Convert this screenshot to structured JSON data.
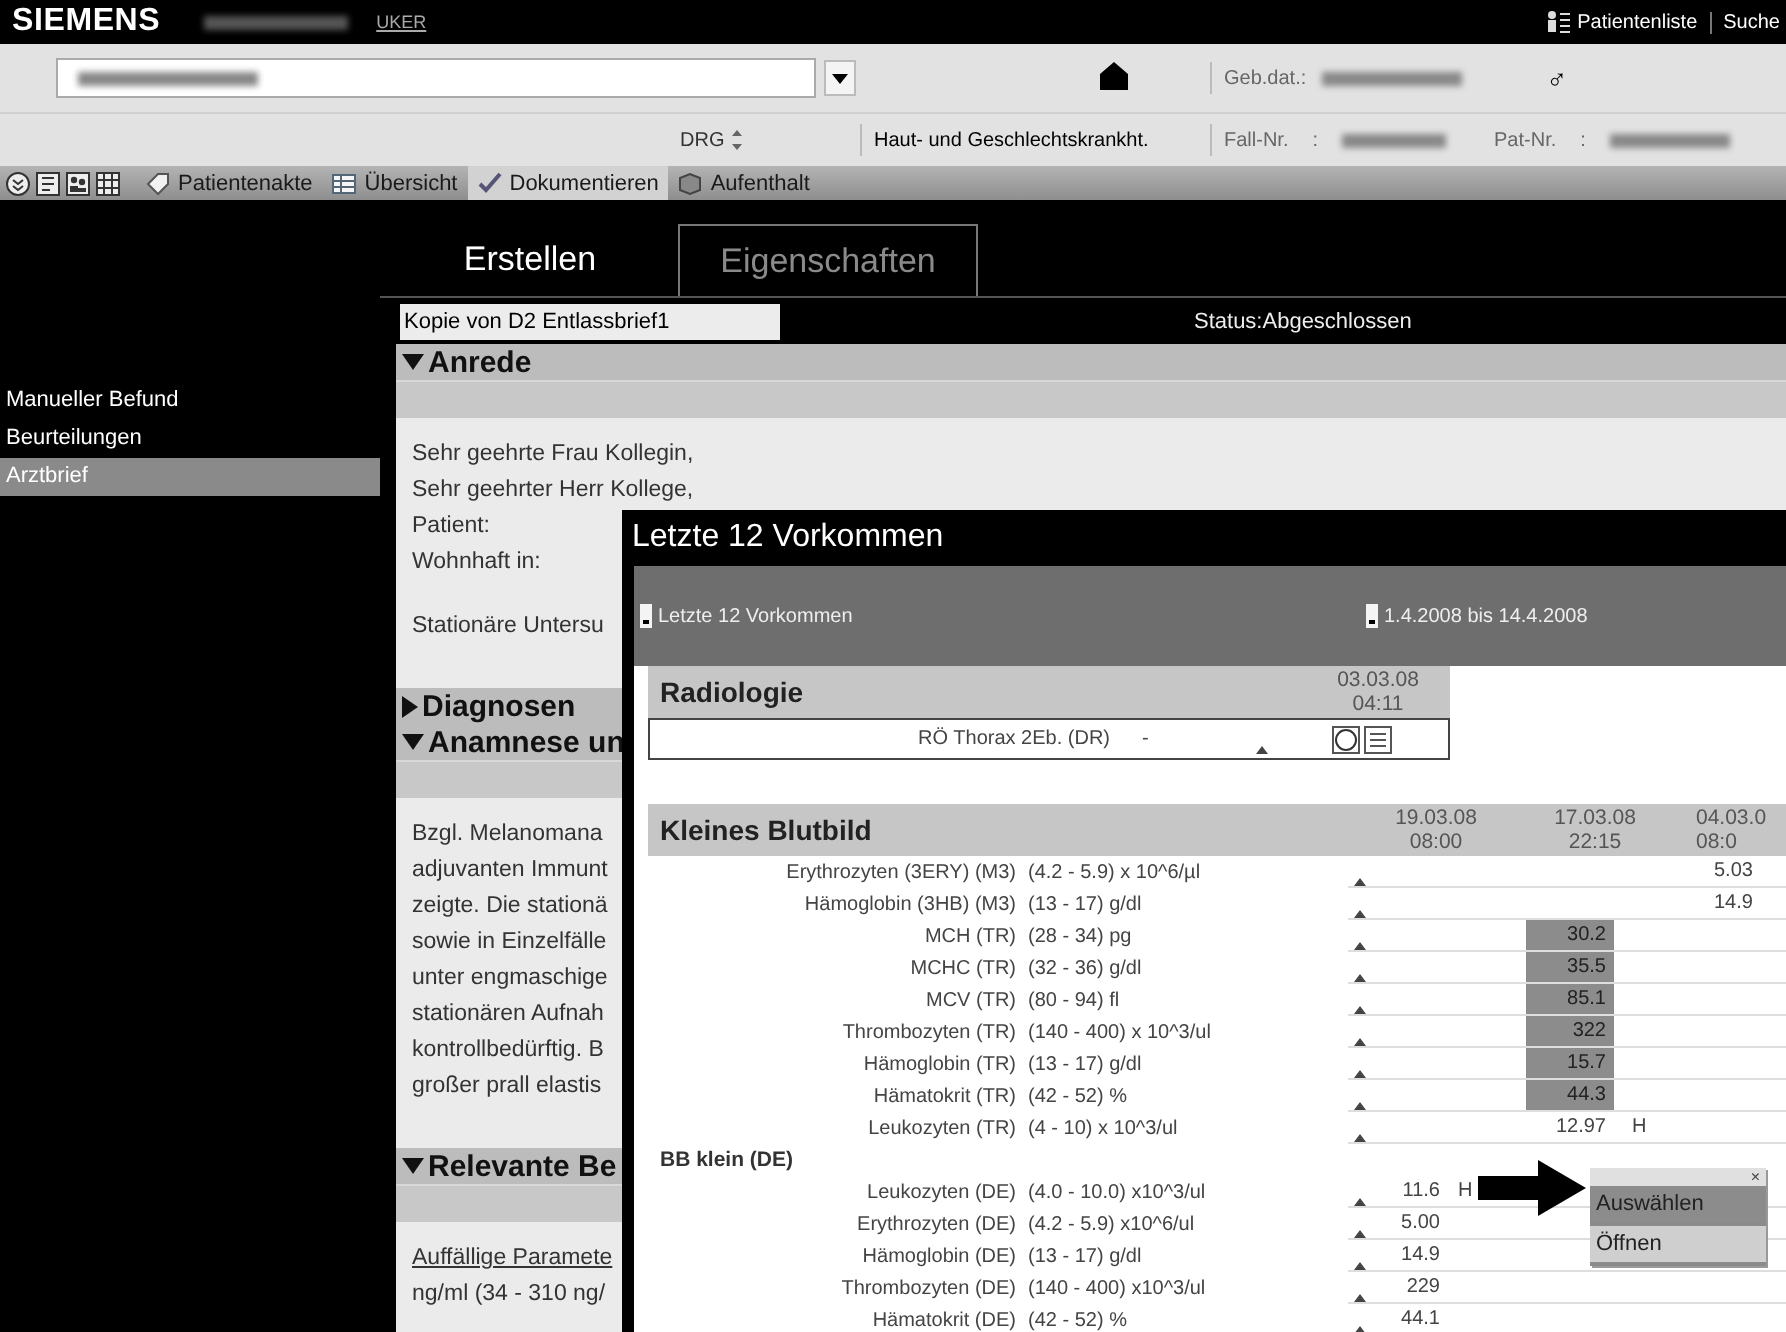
{
  "header": {
    "logo": "SIEMENS",
    "link": "UKER",
    "patient_list": "Patientenliste",
    "search": "Suche"
  },
  "patient_bar": {
    "birth_label": "Geb.dat.:",
    "gender": "♂",
    "drg": "DRG",
    "department": "Haut- und Geschlechtskrankht.",
    "case_label": "Fall-Nr.",
    "case_separator": ":",
    "patient_number_label": "Pat-Nr.",
    "patient_number_separator": ":"
  },
  "toolbar": {
    "items": [
      {
        "label": "Patientenakte",
        "selected": false
      },
      {
        "label": "Übersicht",
        "selected": false
      },
      {
        "label": "Dokumentieren",
        "selected": true
      },
      {
        "label": "Aufenthalt",
        "selected": false
      }
    ]
  },
  "sidebar": {
    "items": [
      {
        "label": "Manueller Befund",
        "selected": false
      },
      {
        "label": "Beurteilungen",
        "selected": false
      },
      {
        "label": "Arztbrief",
        "selected": true
      }
    ]
  },
  "tabs": [
    {
      "label": "Erstellen",
      "selected": true
    },
    {
      "label": "Eigenschaften",
      "selected": false
    }
  ],
  "document": {
    "title": "Kopie von D2 Entlassbrief1",
    "status": "Status:Abgeschlossen",
    "sections": [
      {
        "title": "Anrede",
        "expanded": true,
        "paragraphs": [
          [
            {
              "kind": "text",
              "text": "Sehr geehrte Frau Kollegin,"
            },
            {
              "kind": "text",
              "text": "Sehr geehrter Herr Kollege,"
            },
            {
              "kind": "text",
              "text": "Patient:"
            },
            {
              "kind": "text",
              "text": "Wohnhaft in:"
            }
          ],
          [
            {
              "kind": "text",
              "text": "Stationäre Untersu"
            }
          ]
        ]
      },
      {
        "title": "Diagnosen",
        "expanded": false
      },
      {
        "title": "Anamnese un",
        "expanded": true,
        "paragraphs": [
          [
            {
              "kind": "text",
              "text": "Bzgl. Melanomana"
            },
            {
              "kind": "text",
              "text": "adjuvanten Immunt"
            },
            {
              "kind": "text",
              "text": "zeigte. Die stationä"
            },
            {
              "kind": "text",
              "text": "sowie in Einzelfälle"
            },
            {
              "kind": "text",
              "text": "unter engmaschige"
            },
            {
              "kind": "text",
              "text": "stationären Aufnah"
            },
            {
              "kind": "text",
              "text": "kontrollbedürftig. B"
            },
            {
              "kind": "text",
              "text": "großer prall elastis"
            }
          ]
        ]
      },
      {
        "title": "Relevante Be",
        "expanded": true,
        "paragraphs": [
          [
            {
              "kind": "link",
              "text": "Auffällige Paramete"
            },
            {
              "kind": "text",
              "text": "ng/ml (34 - 310 ng/"
            }
          ]
        ]
      }
    ]
  },
  "popup": {
    "title": "Letzte 12 Vorkommen",
    "filter": "Letzte 12 Vorkommen",
    "range": "1.4.2008 bis 14.4.2008",
    "radiology": {
      "title": "Radiologie",
      "dates": [
        {
          "date": "03.03.08",
          "time": "04:11"
        }
      ],
      "rows": [
        {
          "label": "RÖ Thorax 2Eb. (DR)",
          "range": "-"
        }
      ]
    },
    "blood": {
      "title": "Kleines Blutbild",
      "dates": [
        {
          "date": "19.03.08",
          "time": "08:00"
        },
        {
          "date": "17.03.08",
          "time": "22:15"
        },
        {
          "date": "04.03.0",
          "time": "08:0"
        }
      ],
      "groups": [
        {
          "rows": [
            {
              "label": "Erythrozyten (3ERY) (M3)",
              "range": "(4.2 - 5.9) x 10^6/µl",
              "values": {
                "column_3": {
                  "text": "5.03",
                  "highlighted": false
                }
              }
            },
            {
              "label": "Hämoglobin (3HB) (M3)",
              "range": "(13 - 17) g/dl",
              "values": {
                "column_3": {
                  "text": "14.9",
                  "highlighted": false
                }
              }
            },
            {
              "label": "MCH (TR)",
              "range": "(28 - 34) pg",
              "values": {
                "column_2": {
                  "text": "30.2",
                  "highlighted": true
                }
              }
            },
            {
              "label": "MCHC (TR)",
              "range": "(32 - 36) g/dl",
              "values": {
                "column_2": {
                  "text": "35.5",
                  "highlighted": true
                }
              }
            },
            {
              "label": "MCV (TR)",
              "range": "(80 - 94) fl",
              "values": {
                "column_2": {
                  "text": "85.1",
                  "highlighted": true
                }
              }
            },
            {
              "label": "Thrombozyten (TR)",
              "range": "(140 - 400) x 10^3/ul",
              "values": {
                "column_2": {
                  "text": "322",
                  "highlighted": true
                }
              }
            },
            {
              "label": "Hämoglobin (TR)",
              "range": "(13 - 17) g/dl",
              "values": {
                "column_2": {
                  "text": "15.7",
                  "highlighted": true
                }
              }
            },
            {
              "label": "Hämatokrit (TR)",
              "range": "(42 - 52) %",
              "values": {
                "column_2": {
                  "text": "44.3",
                  "highlighted": true
                }
              }
            },
            {
              "label": "Leukozyten (TR)",
              "range": "(4 - 10) x 10^3/ul",
              "values": {
                "column_2": {
                  "text": "12.97",
                  "flag": "H",
                  "highlighted": false
                }
              }
            }
          ]
        },
        {
          "title": "BB klein (DE)",
          "rows": [
            {
              "label": "Leukozyten (DE)",
              "range": "(4.0 - 10.0) x10^3/ul",
              "values": {
                "column_1": {
                  "text": "11.6",
                  "flag": "H",
                  "highlighted": false
                }
              }
            },
            {
              "label": "Erythrozyten (DE)",
              "range": "(4.2 - 5.9) x10^6/ul",
              "values": {
                "column_1": {
                  "text": "5.00",
                  "highlighted": false
                }
              }
            },
            {
              "label": "Hämoglobin (DE)",
              "range": "(13 - 17) g/dl",
              "values": {
                "column_1": {
                  "text": "14.9",
                  "highlighted": false
                }
              }
            },
            {
              "label": "Thrombozyten (DE)",
              "range": "(140 - 400) x10^3/ul",
              "values": {
                "column_1": {
                  "text": "229",
                  "highlighted": false
                }
              }
            },
            {
              "label": "Hämatokrit (DE)",
              "range": "(42 - 52) %",
              "values": {
                "column_1": {
                  "text": "44.1",
                  "highlighted": false
                }
              }
            }
          ]
        }
      ]
    },
    "context_menu": {
      "close": "×",
      "items": [
        {
          "label": "Auswählen",
          "selected": true
        },
        {
          "label": "Öffnen",
          "selected": false
        }
      ]
    }
  }
}
